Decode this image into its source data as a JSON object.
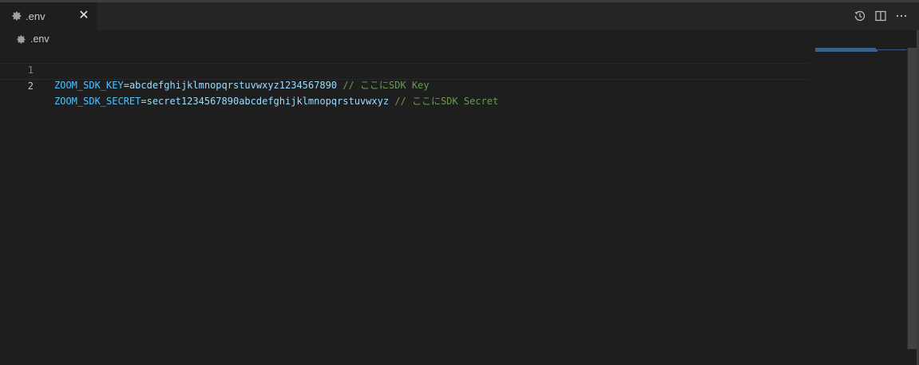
{
  "tab": {
    "label": ".env",
    "close": "✕",
    "icon": "gear-icon"
  },
  "actions": [
    {
      "name": "timeline-icon"
    },
    {
      "name": "split-editor-icon"
    },
    {
      "name": "more-actions-icon"
    }
  ],
  "breadcrumb": {
    "label": ".env",
    "icon": "gear-icon"
  },
  "lines": [
    {
      "number": "1",
      "key": "ZOOM_SDK_KEY",
      "eq": "=",
      "value": "abcdefghijklmnopqrstuvwxyz1234567890",
      "comment": " // ここにSDK Key"
    },
    {
      "number": "2",
      "key": "ZOOM_SDK_SECRET",
      "eq": "=",
      "value": "secret1234567890abcdefghijklmnopqrstuvwxyz",
      "comment": " // ここにSDK Secret"
    }
  ],
  "colors": {
    "background": "#1e1e1e",
    "tabbar": "#252526",
    "key": "#4fc1ff",
    "value": "#9cdcfe",
    "comment": "#6a9955"
  }
}
